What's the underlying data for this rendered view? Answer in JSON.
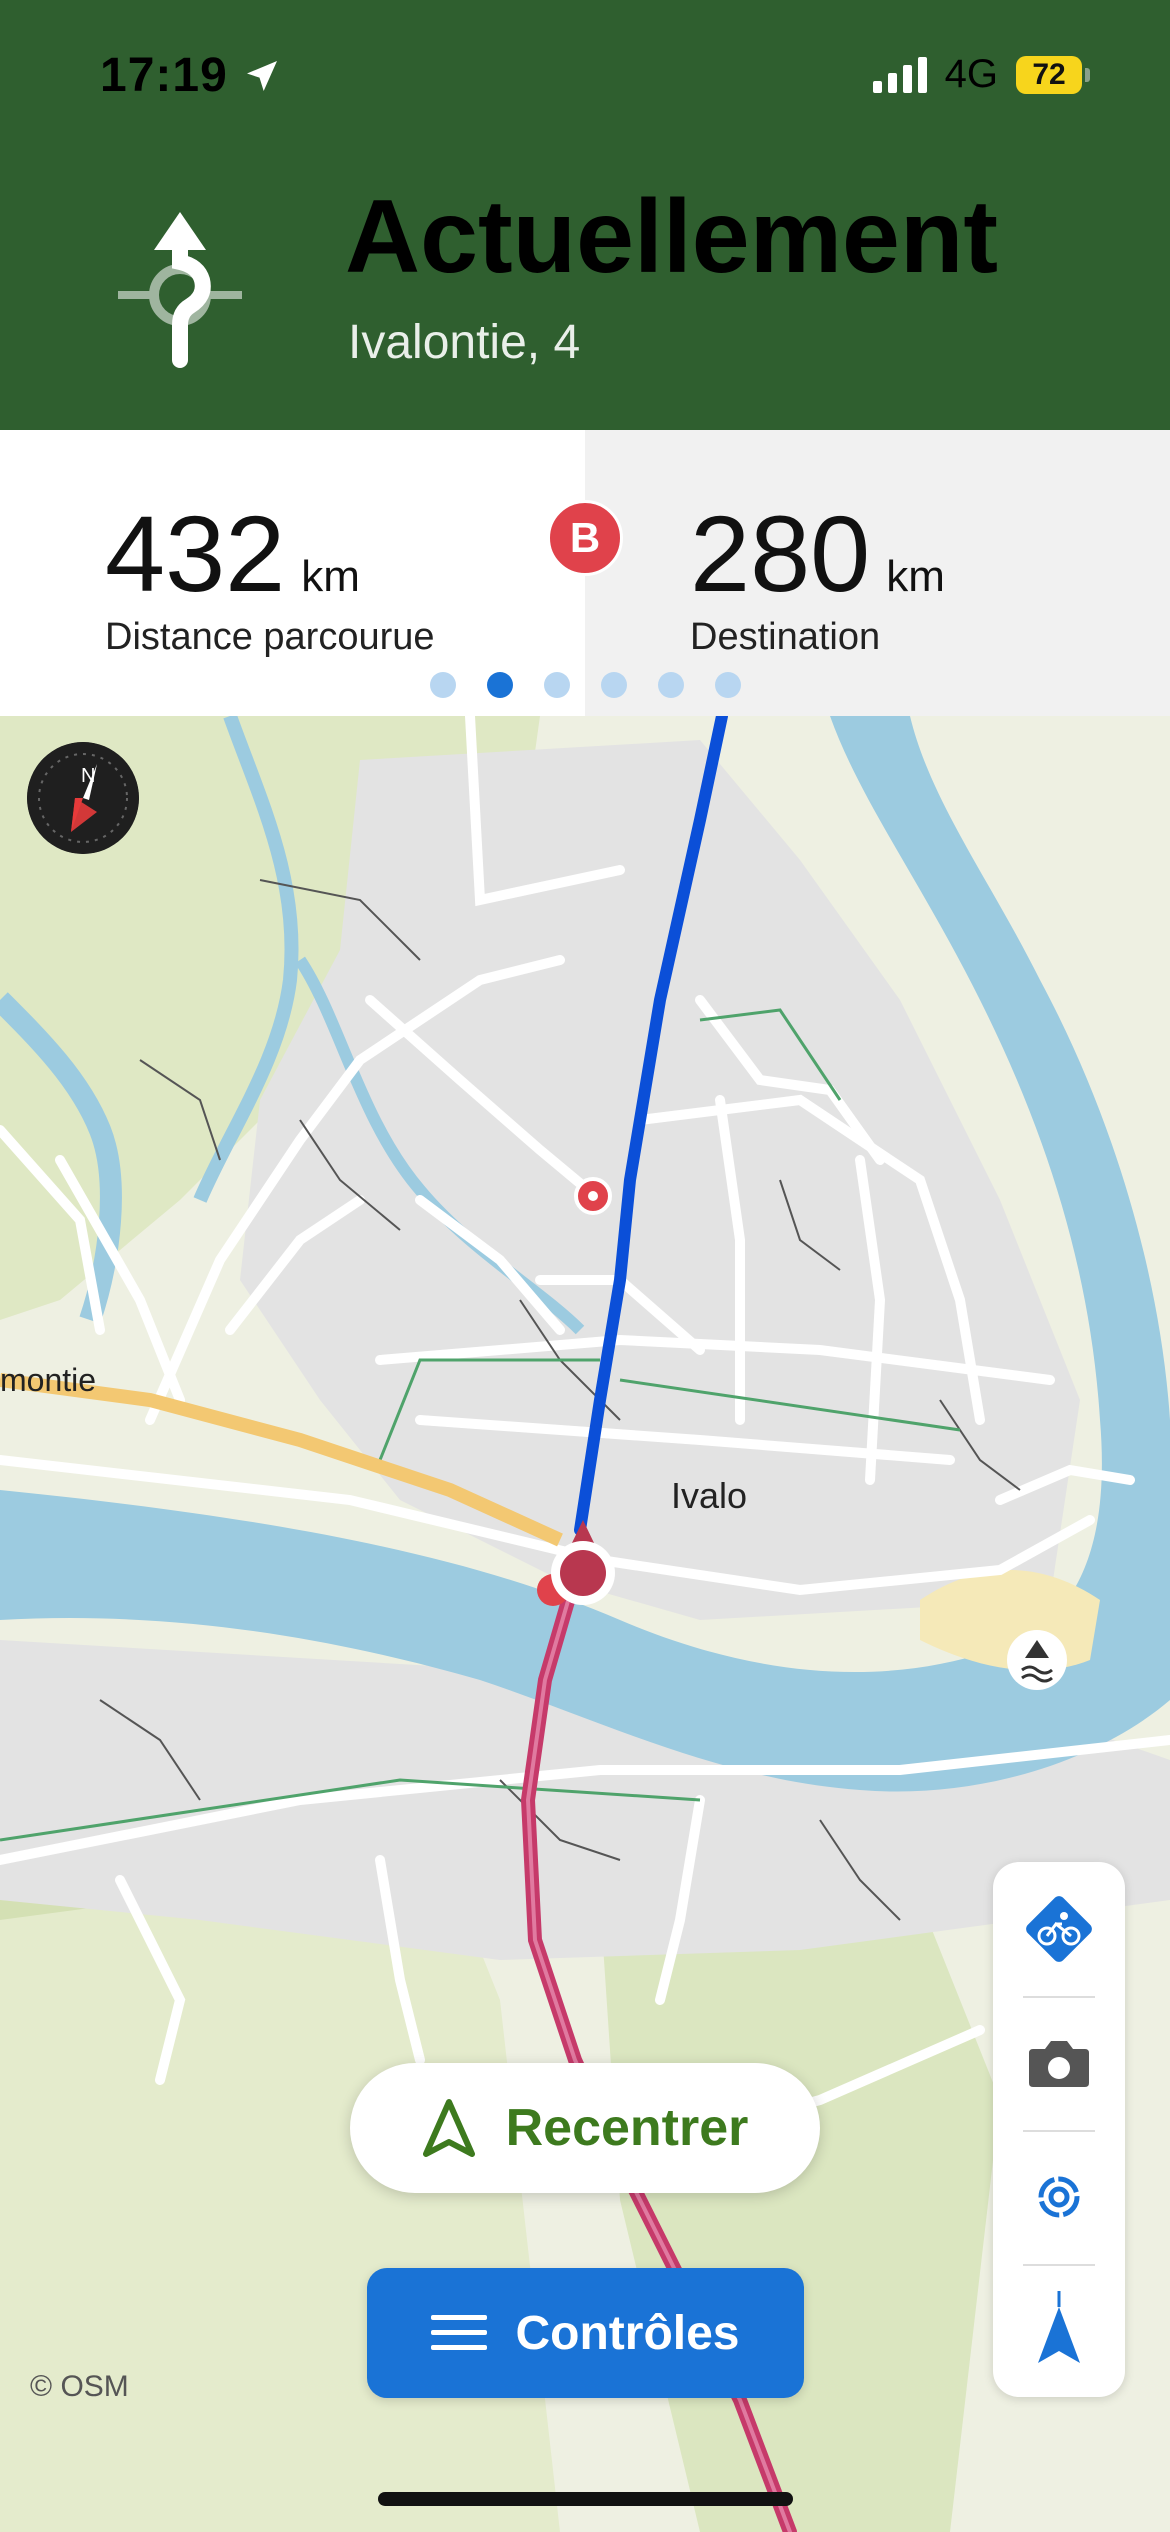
{
  "status_bar": {
    "time": "17:19",
    "network": "4G",
    "battery": "72"
  },
  "maneuver": {
    "title": "Actuellement",
    "subtitle": "Ivalontie, 4"
  },
  "stats": {
    "left": {
      "value": "432",
      "unit": "km",
      "label": "Distance parcourue"
    },
    "right": {
      "value": "280",
      "unit": "km",
      "label": "Destination"
    },
    "badge": "B",
    "page_count": 6,
    "active_page": 2
  },
  "map": {
    "labels": {
      "town": "Ivalo",
      "street": "montie"
    },
    "attribution": "© OSM",
    "colors": {
      "route_ahead": "#0b4fd8",
      "route_behind": "#c63a6a",
      "water": "#9ccbe0",
      "position": "#b8374f"
    }
  },
  "buttons": {
    "recenter": "Recentrer",
    "controls": "Contrôles"
  },
  "tools": [
    "bike-profile-icon",
    "camera-icon",
    "live-tracking-icon",
    "navigation-arrow-icon"
  ]
}
